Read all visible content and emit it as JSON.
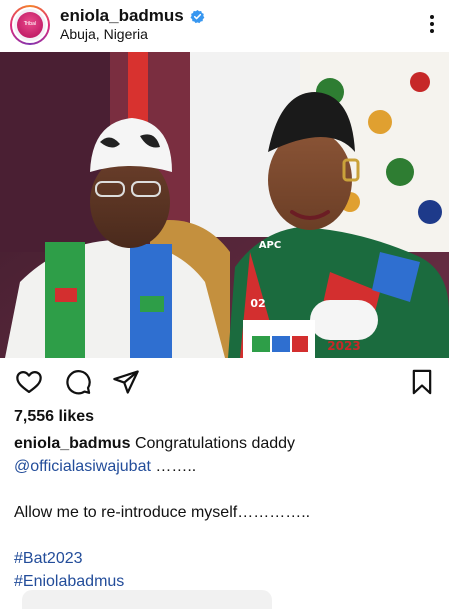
{
  "header": {
    "avatar_text": "Tribal",
    "username": "eniola_badmus",
    "location": "Abuja, Nigeria"
  },
  "photo": {
    "sash_text": "APC",
    "badge_year": "2023",
    "partial_year": "02"
  },
  "likes": "7,556 likes",
  "caption": {
    "username": "eniola_badmus",
    "line1_text": "Congratulations daddy",
    "mention": "@officialasiwajubat",
    "mention_suffix": " ……..",
    "line3": "Allow me to re-introduce myself…………..",
    "hashtag1": "#Bat2023",
    "hashtag2": "#Eniolabadmus"
  },
  "icons": [
    "heart-icon",
    "comment-icon",
    "share-icon",
    "bookmark-icon",
    "more-icon",
    "verified-icon"
  ],
  "colors": {
    "link": "#234d9a",
    "verified": "#3897f0",
    "text": "#111111"
  }
}
